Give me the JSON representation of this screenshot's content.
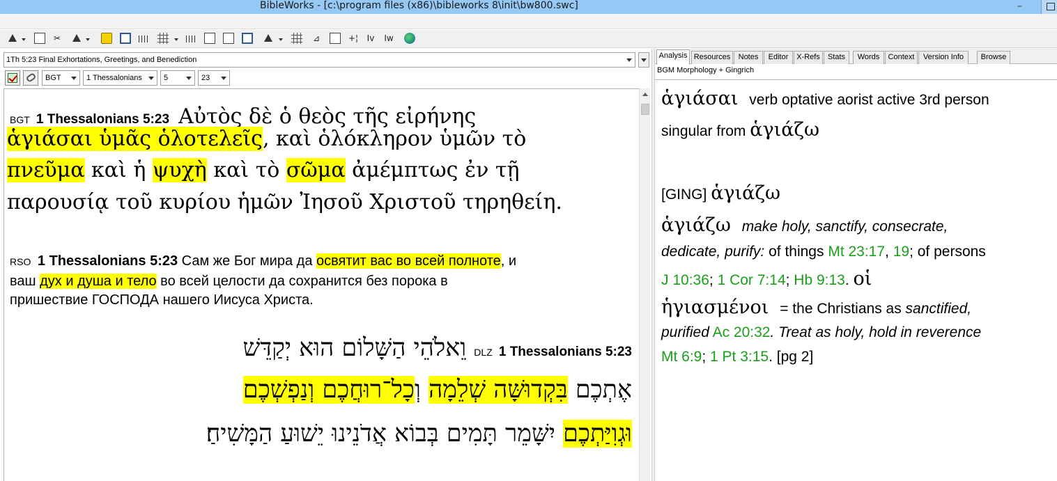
{
  "window": {
    "title": "BibleWorks - [c:\\program files (x86)\\bibleworks 8\\init\\bw800.swc]",
    "minimize_glyph": "–"
  },
  "toolbar": {
    "icons": [
      "search-icon",
      "browse-icon",
      "tools-icon",
      "editor-icon",
      "highlight-icon",
      "window-icon",
      "bars-icon",
      "grid-icon",
      "list-icon",
      "copy-icon",
      "options-icon",
      "print-icon",
      "lexicon-icon",
      "layout-icon",
      "analysis-icon",
      "stamp-icon",
      "plus-icon",
      "iv-icon",
      "iw-icon",
      "globe-icon"
    ],
    "labels": {
      "t17": "+¦",
      "t18": "Iv",
      "t19": "Iw",
      "t16": "⊿"
    }
  },
  "left": {
    "passage": "1Th 5:23 Final Exhortations, Greetings, and Benediction",
    "version_select": "BGT",
    "book_select": "1 Thessalonians",
    "chapter_select": "5",
    "verse_select": "23"
  },
  "bgt": {
    "tag": "BGT",
    "ref": "1 Thessalonians 5:23",
    "l1_text": "Αὐτὸς δὲ ὁ θεὸς τῆς εἰρήνης",
    "l2_hl": "ἁγιάσαι ὑμᾶς ὁλοτελεῖς",
    "l2_rest": ", καὶ ὁλόκληρον ὑμῶν τὸ",
    "l3_a": "πνεῦμα",
    "l3_b": " καὶ ἡ ",
    "l3_c": "ψυχὴ",
    "l3_d": " καὶ τὸ ",
    "l3_e": "σῶμα",
    "l3_f": " ἀμέμπτως ἐν τῇ",
    "l4": "παρουσίᾳ τοῦ κυρίου ἡμῶν Ἰησοῦ Χριστοῦ τηρηθείη."
  },
  "rso": {
    "tag": "RSO",
    "ref": "1 Thessalonians 5:23",
    "l1_pre": " Сам же Бог мира да ",
    "l1_hl": "освятит вас во всей полноте",
    "l1_post": ", и",
    "l2_pre": "ваш ",
    "l2_hl": "дух и душа и тело",
    "l2_post": " во всей целости да сохранится без порока в",
    "l3": "пришествие ГОСПОДА нашего Иисуса Христа."
  },
  "dlz": {
    "tag": "DLZ",
    "ref": "1 Thessalonians 5:23",
    "l1": "וֵאלֹהֵי הַשָּׁלוֹם הוּא יְקַדֵּשׁ",
    "l2_plain": "אֶתְכֶם ",
    "l2_hl1": "בִּקְדוּשָּׁה שְׁלֵמָה",
    "l2_mid": " וְ",
    "l2_hl2": "כָל־רוּחֲכֶם וְנַפְשְׁכֶם",
    "l3_hl": "וּגְוִיַּתְכֶם",
    "l3_rest": " יִשָּׁמֵר תָּמִים בְּבוֹא אֲדֹנֵינוּ יֵשׁוּעַ הַמָּשִׁיחַ׃"
  },
  "right": {
    "tabs": [
      "Analysis",
      "Resources",
      "Notes",
      "Editor",
      "X-Refs",
      "Stats",
      "Words",
      "Context",
      "Version Info",
      "Browse"
    ],
    "lexicon": "BGM Morphology + Gingrich",
    "word": "ἁγιάσαι",
    "parse": "verb optative aorist active 3rd person",
    "parse2": "singular from",
    "lemma": "ἁγιάζω",
    "ging": "[GING]",
    "ging_lemma": "ἁγιάζω",
    "entry_word": "ἁγιάζω",
    "def1": "make holy, sanctify, consecrate,",
    "def2": "dedicate, purify:",
    "of_things": " of things ",
    "ref_mt23": "Mt 23:17",
    "sep1": ", ",
    "ref_19": "19",
    "of_persons": "; of persons",
    "ref_j": "J 10:36",
    "sep2": "; ",
    "ref_1cor": "1 Cor 7:14",
    "sep3": "; ",
    "ref_hb": "Hb 9:13",
    "end1": ".",
    "hoi": "οἱ",
    "hegiasmenoi": "ἡγιασμένοι",
    "christians": "= the Christians as ",
    "sanctified": "sanctified,",
    "purified": "purified",
    "ref_ac": "Ac 20:32",
    "treat": ". Treat as holy, hold in reverence",
    "ref_mt6": "Mt 6:9",
    "sep4": "; ",
    "ref_1pt": "1 Pt 3:15",
    "pg": ". [pg 2]"
  },
  "colors": {
    "highlight": "#ffff00",
    "link_green": "#1aa01a",
    "titlebar": "#96c8f5"
  }
}
